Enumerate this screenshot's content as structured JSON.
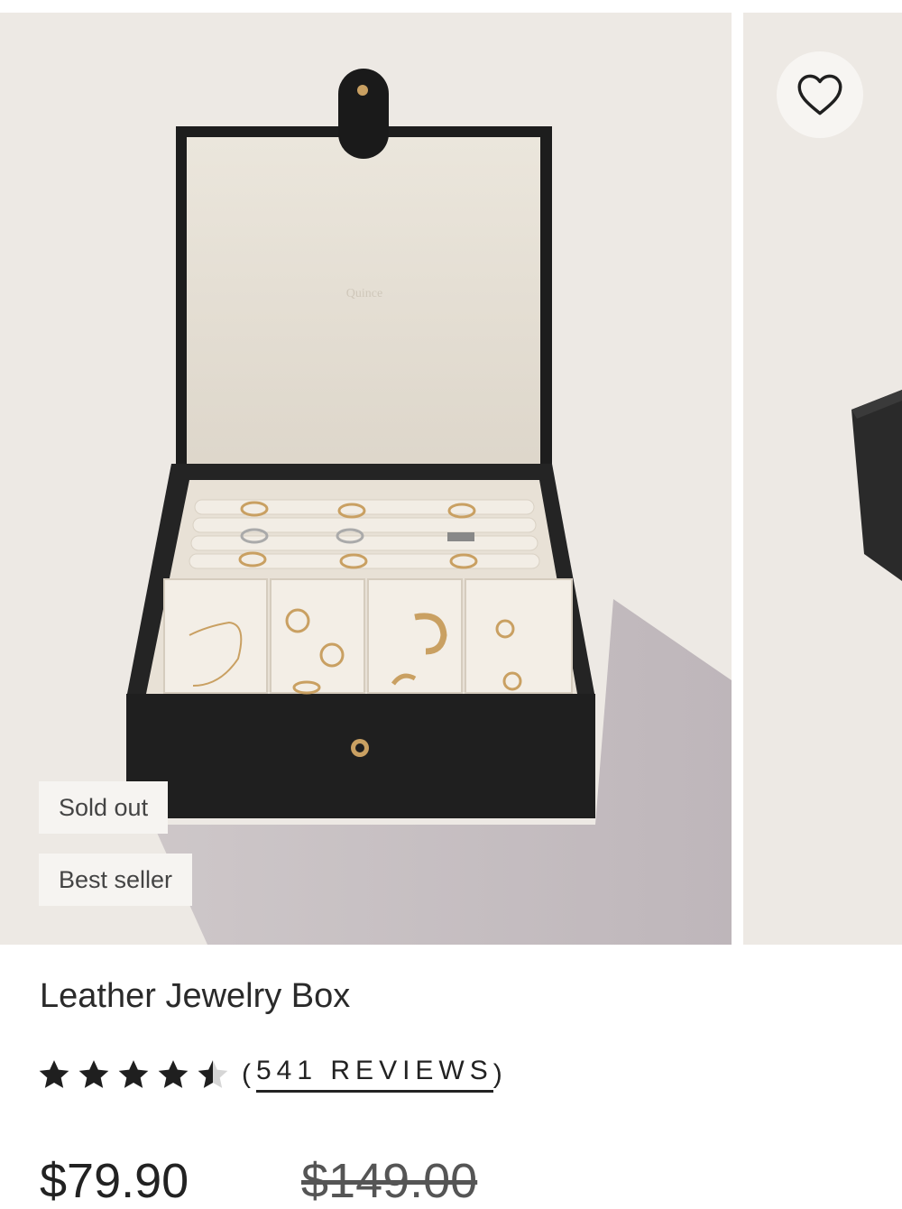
{
  "product": {
    "title": "Leather Jewelry Box",
    "badges": [
      "Sold out",
      "Best seller"
    ],
    "rating": {
      "value": 4.5,
      "max": 5,
      "open_paren": "(",
      "reviews_label": "541 REVIEWS",
      "close_paren": ")"
    },
    "price": {
      "current": "$79.90",
      "original": "$149.00"
    },
    "image_text": "Quince"
  },
  "icons": {
    "favorite": "heart-outline-icon",
    "star": "star-icon"
  },
  "colors": {
    "image_bg": "#ede9e4",
    "box_leather": "#1f1f1f",
    "lining": "#ece6dc",
    "gold": "#c9a062",
    "star": "#1f1f1f"
  }
}
